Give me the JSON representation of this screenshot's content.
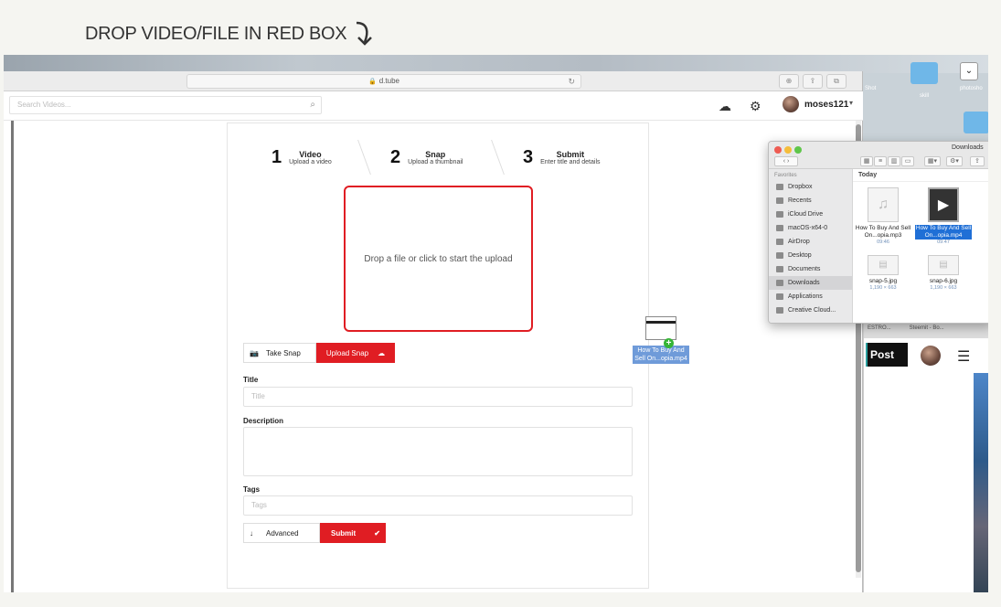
{
  "caption": "DROP VIDEO/FILE IN RED BOX",
  "browser": {
    "url": "d.tube"
  },
  "header": {
    "search_placeholder": "Search Videos...",
    "username": "moses121"
  },
  "steps": [
    {
      "num": "1",
      "title": "Video",
      "subtitle": "Upload a video"
    },
    {
      "num": "2",
      "title": "Snap",
      "subtitle": "Upload a thumbnail"
    },
    {
      "num": "3",
      "title": "Submit",
      "subtitle": "Enter title and details"
    }
  ],
  "dropzone_text": "Drop a file or click to start the upload",
  "snap": {
    "take": "Take Snap",
    "upload": "Upload Snap"
  },
  "form": {
    "title_label": "Title",
    "title_placeholder": "Title",
    "description_label": "Description",
    "tags_label": "Tags",
    "tags_placeholder": "Tags",
    "advanced": "Advanced",
    "submit": "Submit"
  },
  "drag_file": {
    "name": "How To Buy And Sell On...opia.mp4"
  },
  "finder": {
    "title": "Downloads",
    "favorites_label": "Favorites",
    "sidebar": [
      "Dropbox",
      "Recents",
      "iCloud Drive",
      "macOS-x64-0",
      "AirDrop",
      "Desktop",
      "Documents",
      "Downloads",
      "Applications",
      "Creative Cloud..."
    ],
    "section": "Today",
    "files": [
      {
        "name": "How To Buy And Sell On...opia.mp3",
        "meta": "09:46"
      },
      {
        "name": "How To Buy And Sell On...opia.mp4",
        "meta": "09:47"
      },
      {
        "name": "snap-5.jpg",
        "meta": "1,190 × 663"
      },
      {
        "name": "snap-6.jpg",
        "meta": "1,190 × 663"
      }
    ]
  },
  "right_strip": {
    "tab1": "ESTRO...",
    "tab2": "Steemit - Bo...",
    "post": "Post"
  },
  "desktop": {
    "label1": "photosho",
    "label2": "Shot",
    "label3": "skill"
  },
  "colors": {
    "accent": "#e01d23",
    "selection": "#1f6fd6"
  }
}
